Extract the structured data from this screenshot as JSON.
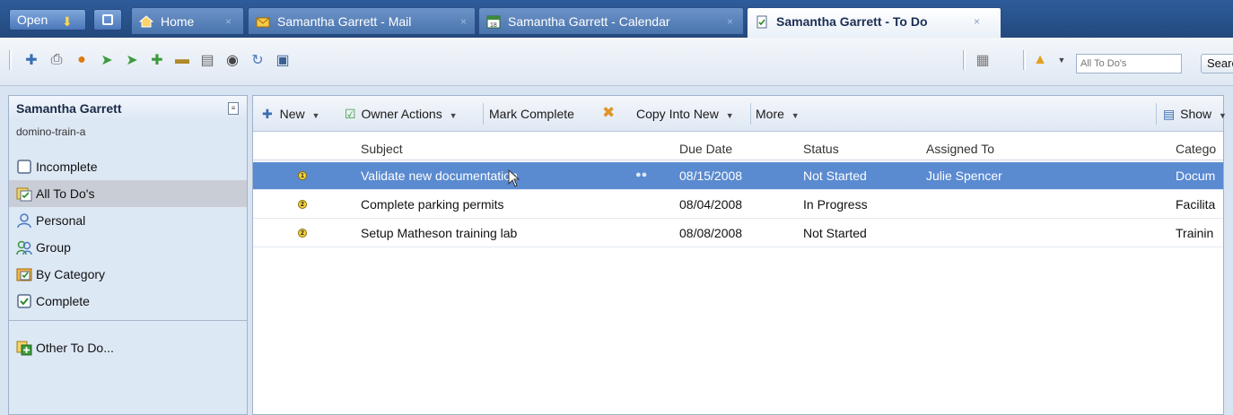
{
  "tabbar": {
    "open_label": "Open",
    "tabs": [
      {
        "label": "Home",
        "close": "×"
      },
      {
        "label": "Samantha Garrett - Mail",
        "close": "×"
      },
      {
        "label": "Samantha Garrett - Calendar",
        "close": "×"
      },
      {
        "label": "Samantha Garrett - To Do",
        "close": "×"
      }
    ]
  },
  "search": {
    "placeholder": "All To Do's",
    "button_label": "Search"
  },
  "sidebar": {
    "title": "Samantha Garrett",
    "server": "domino-train-a",
    "items": [
      {
        "label": "Incomplete"
      },
      {
        "label": "All To Do's"
      },
      {
        "label": "Personal"
      },
      {
        "label": "Group"
      },
      {
        "label": "By Category"
      },
      {
        "label": "Complete"
      }
    ],
    "other_label": "Other To Do..."
  },
  "actions": {
    "new": "New",
    "owner_actions": "Owner Actions",
    "mark_complete": "Mark Complete",
    "copy_into_new": "Copy Into New",
    "more": "More",
    "show": "Show"
  },
  "table": {
    "columns": [
      "Subject",
      "Due Date",
      "Status",
      "Assigned To",
      "Catego"
    ],
    "rows": [
      {
        "priority": "1",
        "subject": "Validate new documentation",
        "due": "08/15/2008",
        "status": "Not Started",
        "assigned": "Julie Spencer",
        "category": "Docum"
      },
      {
        "priority": "2",
        "subject": "Complete parking permits",
        "due": "08/04/2008",
        "status": "In Progress",
        "assigned": "",
        "category": "Facilita"
      },
      {
        "priority": "2",
        "subject": "Setup Matheson training lab",
        "due": "08/08/2008",
        "status": "Not Started",
        "assigned": "",
        "category": "Trainin"
      }
    ]
  },
  "colors": {
    "accent": "#2e5c9a",
    "selection": "#5a8ad0",
    "sidebar_bg": "#dde8f5"
  }
}
